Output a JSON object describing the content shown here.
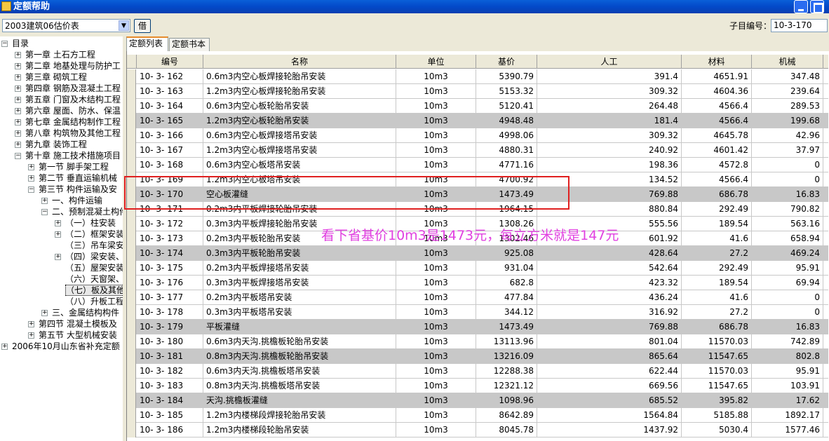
{
  "window": {
    "title": "定额帮助"
  },
  "toolbar": {
    "quota_select": "2003建筑06估价表",
    "borrow_button": "借",
    "sub_code_label": "子目编号：",
    "sub_code_value": "10-3-170"
  },
  "tabs": [
    "定额列表",
    "定额书本"
  ],
  "tree": [
    {
      "label": "目录",
      "exp": "-"
    },
    {
      "label": "第一章  土石方工程",
      "exp": "+"
    },
    {
      "label": "第二章  地基处理与防护工",
      "exp": "+"
    },
    {
      "label": "第三章  砌筑工程",
      "exp": "+"
    },
    {
      "label": "第四章  钢筋及混凝土工程",
      "exp": "+"
    },
    {
      "label": "第五章  门窗及木结构工程",
      "exp": "+"
    },
    {
      "label": "第六章  屋面、防水、保温",
      "exp": "+"
    },
    {
      "label": "第七章  金属结构制作工程",
      "exp": "+"
    },
    {
      "label": "第八章  构筑物及其他工程",
      "exp": "+"
    },
    {
      "label": "第九章  装饰工程",
      "exp": "+"
    },
    {
      "label": "第十章  施工技术措施项目",
      "exp": "-"
    },
    {
      "label": "第一节  脚手架工程",
      "exp": "+"
    },
    {
      "label": "第二节  垂直运输机械",
      "exp": "+"
    },
    {
      "label": "第三节  构件运输及安",
      "exp": "-"
    },
    {
      "label": "一、构件运输",
      "exp": "+"
    },
    {
      "label": "二、预制混凝土构件",
      "exp": "-"
    },
    {
      "label": "（一）柱安装",
      "exp": "+"
    },
    {
      "label": "（二）框架安装",
      "exp": "+"
    },
    {
      "label": "（三）吊车梁安",
      "exp": ""
    },
    {
      "label": "（四）梁安装、",
      "exp": "+"
    },
    {
      "label": "（五）屋架安装",
      "exp": ""
    },
    {
      "label": "（六）天窗架、",
      "exp": ""
    },
    {
      "label": "（七）板及其他",
      "exp": ""
    },
    {
      "label": "（八）升板工程",
      "exp": ""
    },
    {
      "label": "三、金属结构构件",
      "exp": "+"
    },
    {
      "label": "第四节  混凝土模板及",
      "exp": "+"
    },
    {
      "label": "第五节  大型机械安装",
      "exp": "+"
    },
    {
      "label": "2006年10月山东省补充定额",
      "exp": "+"
    }
  ],
  "columns": [
    "编号",
    "名称",
    "单位",
    "基价",
    "人工",
    "材料",
    "机械"
  ],
  "rows": [
    [
      "10- 3- 162",
      "0.6m3内空心板焊接轮胎吊安装",
      "10m3",
      "5390.79",
      "391.4",
      "4651.91",
      "347.48"
    ],
    [
      "10- 3- 163",
      "1.2m3内空心板焊接轮胎吊安装",
      "10m3",
      "5153.32",
      "309.32",
      "4604.36",
      "239.64"
    ],
    [
      "10- 3- 164",
      "0.6m3内空心板轮胎吊安装",
      "10m3",
      "5120.41",
      "264.48",
      "4566.4",
      "289.53"
    ],
    [
      "10- 3- 165",
      "1.2m3内空心板轮胎吊安装",
      "10m3",
      "4948.48",
      "181.4",
      "4566.4",
      "199.68"
    ],
    [
      "10- 3- 166",
      "0.6m3内空心板焊接塔吊安装",
      "10m3",
      "4998.06",
      "309.32",
      "4645.78",
      "42.96"
    ],
    [
      "10- 3- 167",
      "1.2m3内空心板焊接塔吊安装",
      "10m3",
      "4880.31",
      "240.92",
      "4601.42",
      "37.97"
    ],
    [
      "10- 3- 168",
      "0.6m3内空心板塔吊安装",
      "10m3",
      "4771.16",
      "198.36",
      "4572.8",
      "0"
    ],
    [
      "10- 3- 169",
      "1.2m3内空心板塔吊安装",
      "10m3",
      "4700.92",
      "134.52",
      "4566.4",
      "0"
    ],
    [
      "10- 3- 170",
      "空心板灌缝",
      "10m3",
      "1473.49",
      "769.88",
      "686.78",
      "16.83"
    ],
    [
      "10- 3- 171",
      "0.2m3内平板焊接轮胎吊安装",
      "10m3",
      "1964.15",
      "880.84",
      "292.49",
      "790.82"
    ],
    [
      "10- 3- 172",
      "0.3m3内平板焊接轮胎吊安装",
      "10m3",
      "1308.26",
      "555.56",
      "189.54",
      "563.16"
    ],
    [
      "10- 3- 173",
      "0.2m3内平板轮胎吊安装",
      "10m3",
      "1302.46",
      "601.92",
      "41.6",
      "658.94"
    ],
    [
      "10- 3- 174",
      "0.3m3内平板轮胎吊安装",
      "10m3",
      "925.08",
      "428.64",
      "27.2",
      "469.24"
    ],
    [
      "10- 3- 175",
      "0.2m3内平板焊接塔吊安装",
      "10m3",
      "931.04",
      "542.64",
      "292.49",
      "95.91"
    ],
    [
      "10- 3- 176",
      "0.3m3内平板焊接塔吊安装",
      "10m3",
      "682.8",
      "423.32",
      "189.54",
      "69.94"
    ],
    [
      "10- 3- 177",
      "0.2m3内平板塔吊安装",
      "10m3",
      "477.84",
      "436.24",
      "41.6",
      "0"
    ],
    [
      "10- 3- 178",
      "0.3m3内平板塔吊安装",
      "10m3",
      "344.12",
      "316.92",
      "27.2",
      "0"
    ],
    [
      "10- 3- 179",
      "平板灌缝",
      "10m3",
      "1473.49",
      "769.88",
      "686.78",
      "16.83"
    ],
    [
      "10- 3- 180",
      "0.6m3内天沟.挑檐板轮胎吊安装",
      "10m3",
      "13113.96",
      "801.04",
      "11570.03",
      "742.89"
    ],
    [
      "10- 3- 181",
      "0.8m3内天沟.挑檐板轮胎吊安装",
      "10m3",
      "13216.09",
      "865.64",
      "11547.65",
      "802.8"
    ],
    [
      "10- 3- 182",
      "0.6m3内天沟.挑檐板塔吊安装",
      "10m3",
      "12288.38",
      "622.44",
      "11570.03",
      "95.91"
    ],
    [
      "10- 3- 183",
      "0.8m3内天沟.挑檐板塔吊安装",
      "10m3",
      "12321.12",
      "669.56",
      "11547.65",
      "103.91"
    ],
    [
      "10- 3- 184",
      "天沟.挑檐板灌缝",
      "10m3",
      "1098.96",
      "685.52",
      "395.82",
      "17.62"
    ],
    [
      "10- 3- 185",
      "1.2m3内楼梯段焊接轮胎吊安装",
      "10m3",
      "8642.89",
      "1564.84",
      "5185.88",
      "1892.17"
    ],
    [
      "10- 3- 186",
      "1.2m3内楼梯段轮胎吊安装",
      "10m3",
      "8045.78",
      "1437.92",
      "5030.4",
      "1577.46"
    ]
  ],
  "gray_rows": [
    3,
    8,
    12,
    17,
    19,
    22
  ],
  "annotation": "看下省基价10m3是1473元，每立方米就是147元",
  "colors": {
    "title_bar": "#0349c9",
    "gray_row": "#c8c8c8",
    "highlight_border": "#e02020",
    "annotation": "#e040e0"
  }
}
